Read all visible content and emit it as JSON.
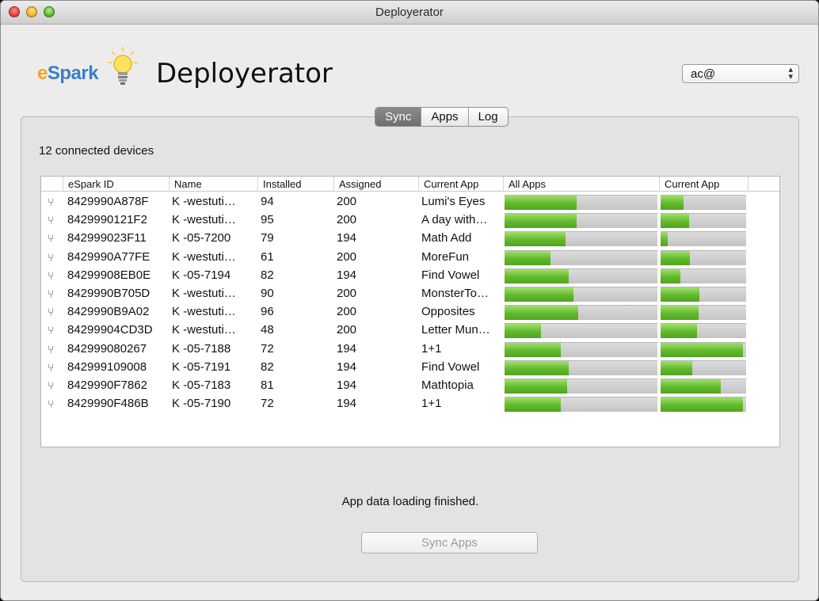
{
  "window": {
    "title": "Deployerator"
  },
  "logo": {
    "text_e": "e",
    "text_rest": "Spark"
  },
  "header": {
    "title": "Deployerator"
  },
  "account": {
    "selected": "ac@"
  },
  "tabs": [
    {
      "label": "Sync",
      "active": true
    },
    {
      "label": "Apps",
      "active": false
    },
    {
      "label": "Log",
      "active": false
    }
  ],
  "devices": {
    "count_label": "12 connected devices"
  },
  "table": {
    "columns": [
      "eSpark ID",
      "Name",
      "Installed",
      "Assigned",
      "Current App",
      "All Apps",
      "Current App"
    ],
    "rows": [
      {
        "id": "8429990A878F",
        "name": "K -westuti…",
        "installed": "94",
        "assigned": "200",
        "current_app": "Lumi's Eyes",
        "all_apps": 0.47,
        "current_progress": 0.27
      },
      {
        "id": "8429990121F2",
        "name": "K -westuti…",
        "installed": "95",
        "assigned": "200",
        "current_app": "A day with…",
        "all_apps": 0.47,
        "current_progress": 0.33
      },
      {
        "id": "842999023F11",
        "name": "K -05-7200",
        "installed": "79",
        "assigned": "194",
        "current_app": "Math Add",
        "all_apps": 0.4,
        "current_progress": 0.08
      },
      {
        "id": "8429990A77FE",
        "name": "K -westuti…",
        "installed": "61",
        "assigned": "200",
        "current_app": "MoreFun",
        "all_apps": 0.3,
        "current_progress": 0.34
      },
      {
        "id": "84299908EB0E",
        "name": "K -05-7194",
        "installed": "82",
        "assigned": "194",
        "current_app": "Find Vowel",
        "all_apps": 0.42,
        "current_progress": 0.23
      },
      {
        "id": "8429990B705D",
        "name": "K -westuti…",
        "installed": "90",
        "assigned": "200",
        "current_app": "MonsterTo…",
        "all_apps": 0.45,
        "current_progress": 0.45
      },
      {
        "id": "8429990B9A02",
        "name": "K -westuti…",
        "installed": "96",
        "assigned": "200",
        "current_app": "Opposites",
        "all_apps": 0.48,
        "current_progress": 0.44
      },
      {
        "id": "84299904CD3D",
        "name": "K -westuti…",
        "installed": "48",
        "assigned": "200",
        "current_app": "Letter Mun…",
        "all_apps": 0.24,
        "current_progress": 0.43
      },
      {
        "id": "842999080267",
        "name": "K -05-7188",
        "installed": "72",
        "assigned": "194",
        "current_app": "1+1",
        "all_apps": 0.37,
        "current_progress": 0.96
      },
      {
        "id": "842999109008",
        "name": "K -05-7191",
        "installed": "82",
        "assigned": "194",
        "current_app": "Find Vowel",
        "all_apps": 0.42,
        "current_progress": 0.37
      },
      {
        "id": "8429990F7862",
        "name": "K -05-7183",
        "installed": "81",
        "assigned": "194",
        "current_app": "Mathtopia",
        "all_apps": 0.41,
        "current_progress": 0.7
      },
      {
        "id": "8429990F486B",
        "name": "K -05-7190",
        "installed": "72",
        "assigned": "194",
        "current_app": "1+1",
        "all_apps": 0.37,
        "current_progress": 0.96
      }
    ]
  },
  "status": {
    "message": "App data loading finished."
  },
  "actions": {
    "sync_label": "Sync Apps"
  },
  "colors": {
    "progress_fill": "#62b82d",
    "progress_track": "#cfcfcf",
    "logo_orange": "#f5a623",
    "logo_blue": "#3a7ec8"
  },
  "icons": {
    "row_icon": "usb-icon",
    "bulb": "lightbulb-icon"
  }
}
